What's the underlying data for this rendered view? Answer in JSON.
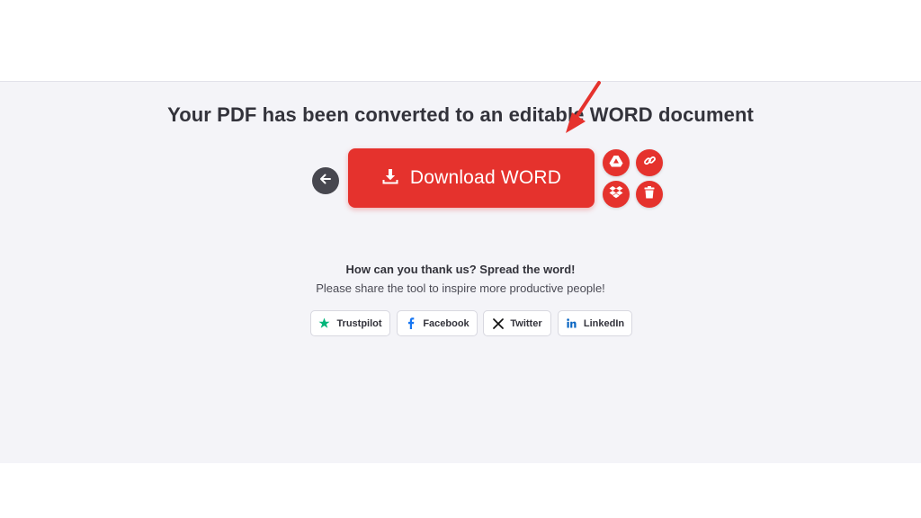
{
  "main": {
    "title": "Your PDF has been converted to an editable WORD document",
    "download_label": "Download WORD",
    "accent_color": "#e5322d"
  },
  "side_tools": {
    "items": [
      {
        "name": "google-drive",
        "icon": "google-drive-icon"
      },
      {
        "name": "share-link",
        "icon": "link-icon"
      },
      {
        "name": "dropbox",
        "icon": "dropbox-icon"
      },
      {
        "name": "delete",
        "icon": "trash-icon"
      }
    ]
  },
  "back": {
    "icon": "arrow-left-icon"
  },
  "share": {
    "heading": "How can you thank us? Spread the word!",
    "subheading": "Please share the tool to inspire more productive people!",
    "buttons": [
      {
        "label": "Trustpilot",
        "icon": "star-icon",
        "color": "#00b67a"
      },
      {
        "label": "Facebook",
        "icon": "facebook-icon",
        "color": "#1877f2"
      },
      {
        "label": "Twitter",
        "icon": "x-icon",
        "color": "#000000"
      },
      {
        "label": "LinkedIn",
        "icon": "linkedin-icon",
        "color": "#0a66c2"
      }
    ]
  }
}
